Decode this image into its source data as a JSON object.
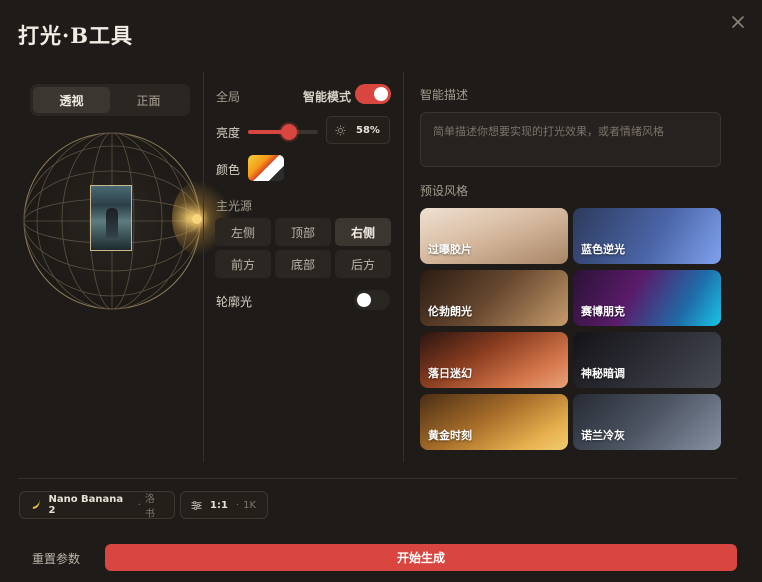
{
  "app": {
    "title": "打光·B工具"
  },
  "view_toggle": {
    "options": [
      "透视",
      "正面"
    ],
    "active_index": 0
  },
  "global": {
    "section_label": "全局",
    "smart_mode_label": "智能模式",
    "smart_mode_on": true,
    "brightness_label": "亮度",
    "brightness_value": "58%",
    "brightness_fraction": 0.58,
    "color_label": "颜色"
  },
  "main_light": {
    "section_label": "主光源",
    "directions": [
      "左侧",
      "顶部",
      "右侧",
      "前方",
      "底部",
      "后方"
    ],
    "active": "右侧"
  },
  "rim_light": {
    "label": "轮廓光",
    "on": false
  },
  "smart_desc": {
    "label": "智能描述",
    "placeholder": "简单描述你想要实现的打光效果，或者情绪风格"
  },
  "presets": {
    "label": "预设风格",
    "items": [
      "过曝胶片",
      "蓝色逆光",
      "伦勃朗光",
      "赛博朋克",
      "落日迷幻",
      "神秘暗调",
      "黄金时刻",
      "诺兰冷灰"
    ]
  },
  "footer": {
    "model_name": "Nano Banana 2",
    "model_sub": "洛书",
    "ratio": "1:1",
    "resolution": "1K",
    "reset_label": "重置参数",
    "generate_label": "开始生成"
  },
  "colors": {
    "accent": "#d8463f",
    "background": "#1e1b18"
  }
}
